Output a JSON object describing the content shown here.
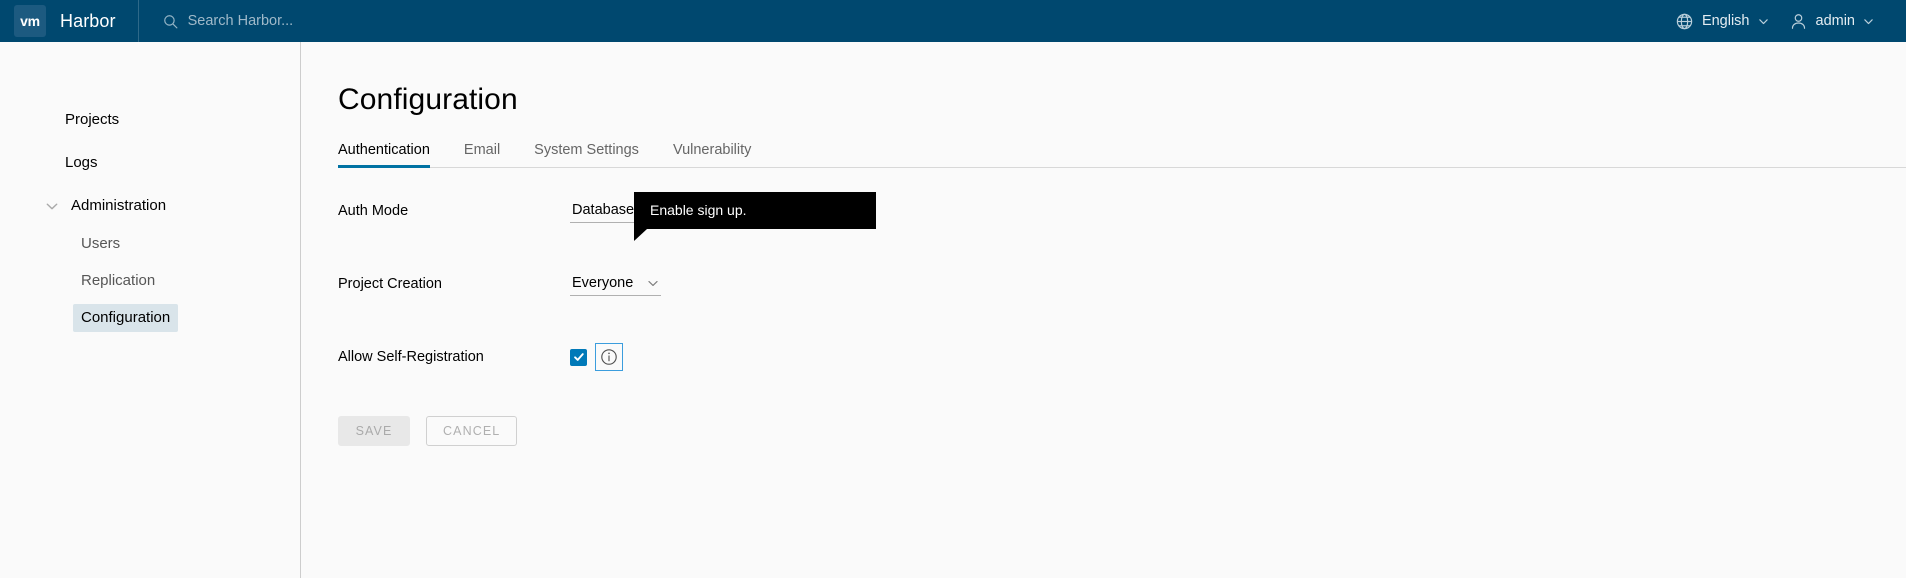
{
  "header": {
    "logo_text": "vm",
    "logo_name": "vmware-logo-icon",
    "title": "Harbor",
    "search": {
      "placeholder": "Search Harbor...",
      "value": "",
      "icon": "search-icon"
    },
    "language": {
      "label": "English",
      "icon": "globe-icon",
      "caret": "chevron-down-icon"
    },
    "account": {
      "label": "admin",
      "icon": "user-icon",
      "caret": "chevron-down-icon"
    }
  },
  "sidebar": {
    "items": [
      {
        "label": "Projects",
        "type": "top"
      },
      {
        "label": "Logs",
        "type": "top"
      },
      {
        "label": "Administration",
        "type": "group",
        "expanded": true,
        "icon": "chevron-down-icon"
      },
      {
        "label": "Users",
        "type": "sub",
        "active": false
      },
      {
        "label": "Replication",
        "type": "sub",
        "active": false
      },
      {
        "label": "Configuration",
        "type": "sub",
        "active": true
      }
    ]
  },
  "main": {
    "page_title": "Configuration",
    "tabs": [
      {
        "label": "Authentication",
        "active": true
      },
      {
        "label": "Email",
        "active": false
      },
      {
        "label": "System Settings",
        "active": false
      },
      {
        "label": "Vulnerability",
        "active": false
      }
    ],
    "form": {
      "auth_mode": {
        "label": "Auth Mode",
        "value": "Database",
        "caret": "chevron-down-icon",
        "info_icon": "info-circle-icon"
      },
      "project_creation": {
        "label": "Project Creation",
        "value": "Everyone"
      },
      "self_registration": {
        "label": "Allow Self-Registration",
        "checked": true,
        "check_glyph": "checkmark-icon",
        "info_icon": "info-circle-icon"
      }
    },
    "tooltip": {
      "text": "Enable sign up."
    },
    "buttons": {
      "save": "SAVE",
      "cancel": "CANCEL"
    }
  },
  "colors": {
    "header_bg": "#00486f",
    "logo_bg": "#1c5a80",
    "accent": "#0072a3",
    "checkbox": "#0079b8",
    "focus_ring": "#3b9ddd",
    "sidebar_active_bg": "#d9e4ea",
    "page_bg": "#fafafa",
    "tooltip_bg": "#000000"
  }
}
